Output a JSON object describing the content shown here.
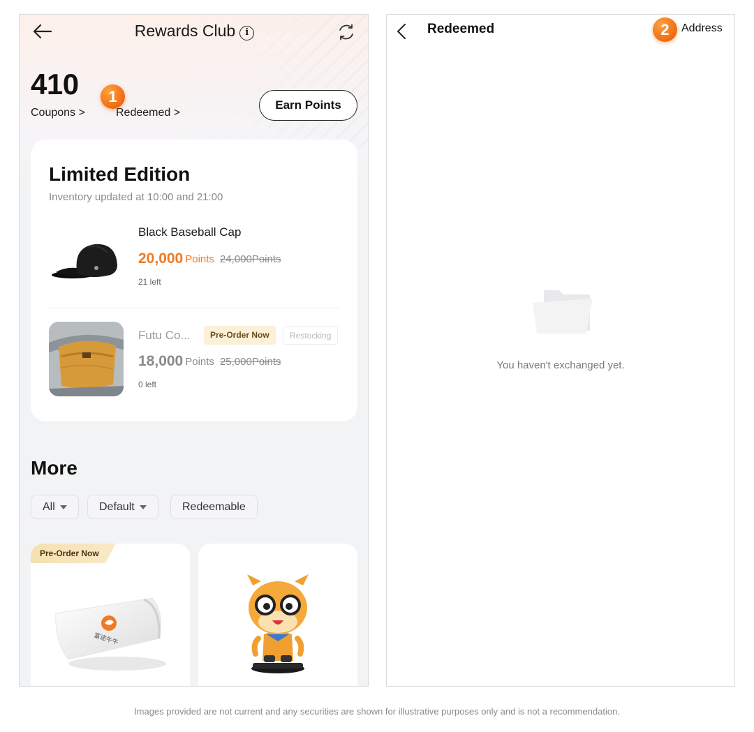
{
  "rewards_club": {
    "header": {
      "title": "Rewards Club"
    },
    "points_value": "410",
    "links": {
      "coupons": "Coupons >",
      "redeemed": "Redeemed >"
    },
    "step_badge": "1",
    "earn_button": "Earn Points",
    "limited": {
      "title": "Limited Edition",
      "subtitle": "Inventory updated at 10:00 and 21:00",
      "items": [
        {
          "name": "Black Baseball Cap",
          "price": "20,000",
          "unit": "Points",
          "old_price": "24,000Points",
          "left": "21 left"
        },
        {
          "name": "Futu Co...",
          "tag_preorder": "Pre-Order Now",
          "tag_restock": "Restocking",
          "price": "18,000",
          "unit": "Points",
          "old_price": "25,000Points",
          "left": "0 left"
        }
      ]
    },
    "more": {
      "title": "More",
      "filters": {
        "all": "All",
        "default": "Default",
        "redeemable": "Redeemable"
      },
      "products": [
        {
          "tag": "Pre-Order Now"
        }
      ]
    }
  },
  "redeemed_page": {
    "title": "Redeemed",
    "step_badge": "2",
    "address_link": "Address",
    "empty_text": "You haven't exchanged yet."
  },
  "disclaimer": "Images provided are not current and any securities are shown for illustrative purposes only and is not a recommendation.",
  "colors": {
    "accent_orange": "#f07a22",
    "badge_orange": "#f06a12",
    "preorder_tag_bg": "#fbf0d8"
  },
  "icons": [
    "back-arrow-icon",
    "info-icon",
    "refresh-icon",
    "chevron-left-icon",
    "empty-folder-icon",
    "caret-down-icon"
  ]
}
